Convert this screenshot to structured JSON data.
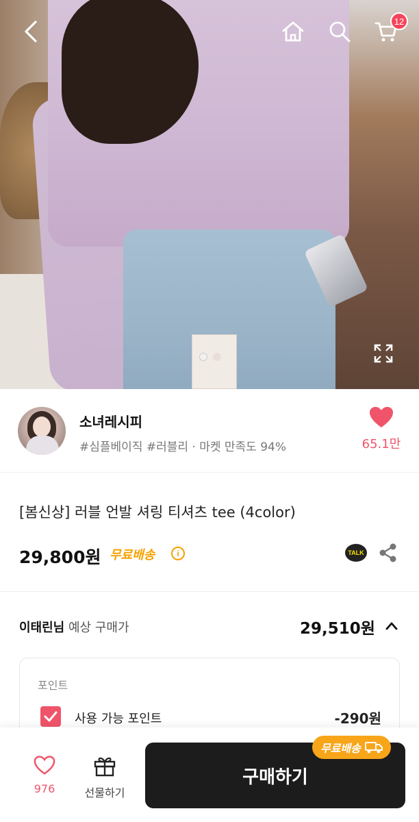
{
  "header": {
    "cart_count": "12"
  },
  "seller": {
    "name": "소녀레시피",
    "tags": "#심플베이직 #러블리 · 마켓 만족도 94%",
    "likes": "65.1만"
  },
  "product": {
    "title": "[봄신상] 러블 언발 셔링 티셔츠 tee (4color)",
    "price": "29,800원",
    "shipping": "무료배송",
    "talk_label": "TALK"
  },
  "expected": {
    "user": "이태린님",
    "label": "예상 구매가",
    "price": "29,510원",
    "points_title": "포인트",
    "points_label": "사용 가능 포인트",
    "points_value": "-290원"
  },
  "bottom_bar": {
    "wish_count": "976",
    "gift_label": "선물하기",
    "buy_label": "구매하기",
    "shipping_pill": "무료배송"
  },
  "colors": {
    "accent_pink": "#f0546a",
    "shipping_orange": "#f5a100",
    "buy_button": "#1c1c1c"
  }
}
